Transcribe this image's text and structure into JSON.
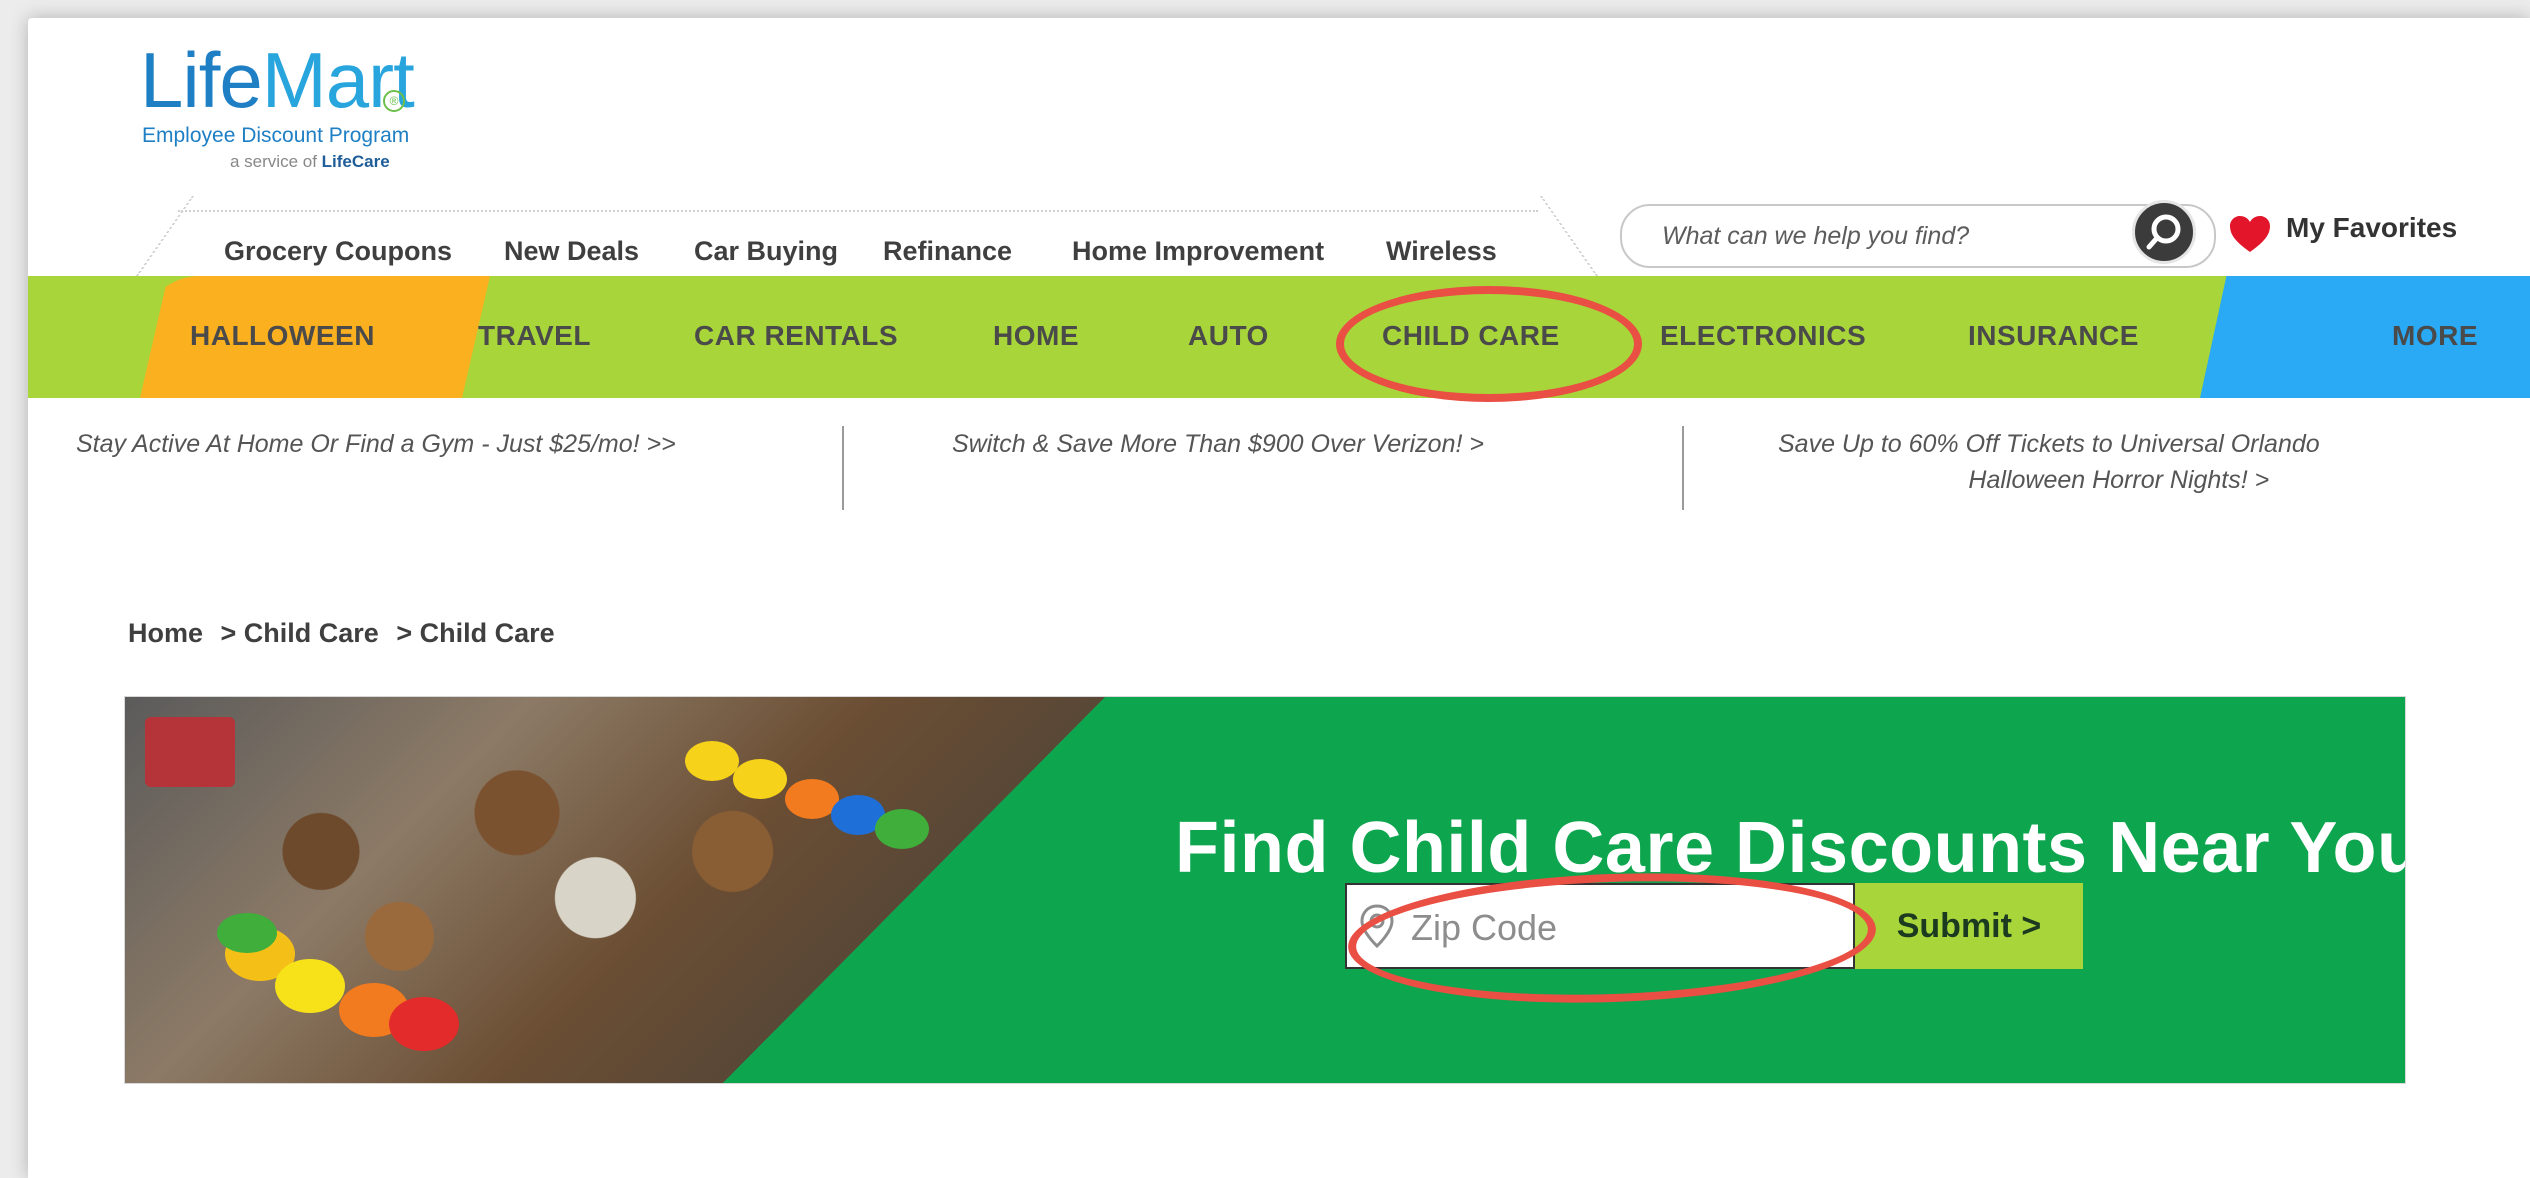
{
  "logo": {
    "life": "Life",
    "mart": "Mart",
    "reg": "®",
    "subtitle": "Employee Discount Program",
    "service_prefix": "a service of ",
    "service_brand": "LifeCare"
  },
  "topnav": {
    "items": [
      "Grocery Coupons",
      "New Deals",
      "Car Buying",
      "Refinance",
      "Home Improvement",
      "Wireless"
    ]
  },
  "search": {
    "placeholder": "What can we help you find?"
  },
  "favorites": {
    "label": "My Favorites"
  },
  "mainnav": {
    "items": [
      "HALLOWEEN",
      "TRAVEL",
      "CAR RENTALS",
      "HOME",
      "AUTO",
      "CHILD CARE",
      "ELECTRONICS",
      "INSURANCE",
      "MORE"
    ],
    "active": "CHILD CARE"
  },
  "promos": [
    {
      "line1": "Stay Active At Home Or Find a Gym - Just $25/mo! >>",
      "line2": ""
    },
    {
      "line1": "Switch & Save More Than $900 Over Verizon! >",
      "line2": ""
    },
    {
      "line1": "Save Up to 60% Off Tickets to Universal Orlando",
      "line2": "Halloween Horror Nights! >"
    }
  ],
  "breadcrumb": [
    "Home",
    "> Child Care",
    "> Child Care"
  ],
  "hero": {
    "title": "Find Child Care Discounts Near You!",
    "zip_placeholder": "Zip Code",
    "submit_label": "Submit >"
  },
  "colors": {
    "nav_green": "#a8d63a",
    "halloween_orange": "#fbb020",
    "more_blue": "#2aa9f4",
    "hero_green": "#0ea54f",
    "annotation_red": "#e94f43",
    "brand_blue": "#1f7fc4"
  },
  "icons": {
    "search_button": "magnifier-icon",
    "favorites": "heart-icon",
    "zip_field": "map-pin-icon"
  }
}
